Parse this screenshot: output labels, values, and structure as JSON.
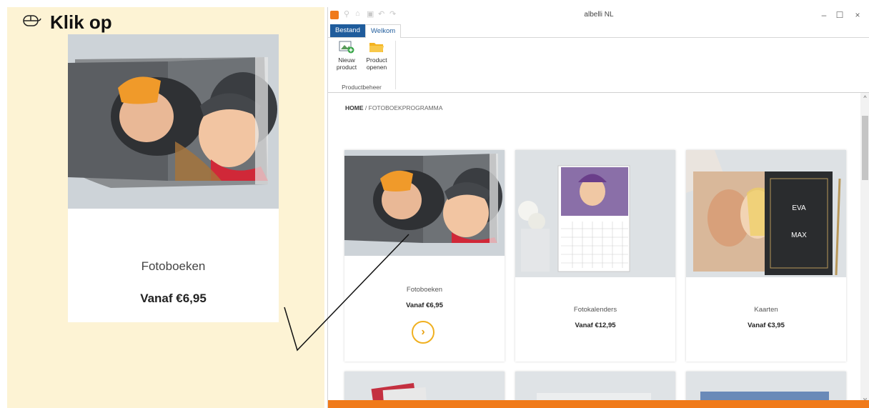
{
  "instruction": {
    "title": "Klik op",
    "icon": "mouse-icon",
    "zoom_card": {
      "name": "Fotoboeken",
      "price": "Vanaf €6,95"
    }
  },
  "window": {
    "title": "albelli NL",
    "controls": {
      "minimize": "–",
      "maximize": "☐",
      "close": "×"
    },
    "tabs": [
      {
        "label": "Bestand"
      },
      {
        "label": "Welkom"
      }
    ],
    "ribbon": {
      "buttons": [
        {
          "label": "Nieuw product"
        },
        {
          "label": "Product openen"
        }
      ],
      "group_label": "Productbeheer"
    },
    "breadcrumb": {
      "home": "HOME",
      "separator": "/",
      "current": "FOTOBOEKPROGRAMMA"
    },
    "products": [
      {
        "name": "Fotoboeken",
        "price": "Vanaf €6,95",
        "button": "›"
      },
      {
        "name": "Fotokalenders",
        "price": "Vanaf €12,95"
      },
      {
        "name": "Kaarten",
        "price": "Vanaf €3,95"
      }
    ]
  },
  "colors": {
    "accent": "#f07a1a",
    "file_tab": "#1f5c9c",
    "highlight_panel": "#fdf3d4",
    "go_button": "#f0b020"
  }
}
